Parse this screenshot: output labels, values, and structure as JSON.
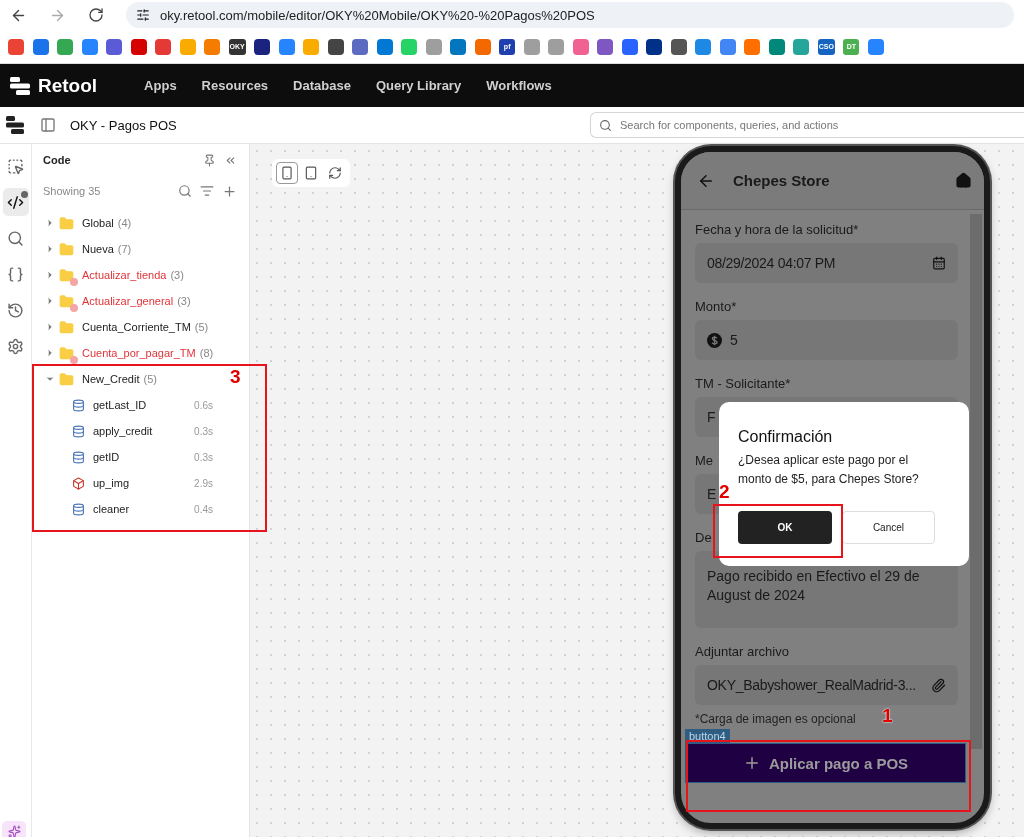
{
  "browser": {
    "url": "oky.retool.com/mobile/editor/OKY%20Mobile/OKY%20-%20Pagos%20POS",
    "bookmarks": [
      {
        "color": "#ea4335"
      },
      {
        "color": "#1a73e8"
      },
      {
        "color": "#34a853"
      },
      {
        "color": "#2684ff"
      },
      {
        "color": "#5b5bd6"
      },
      {
        "color": "#d50000"
      },
      {
        "color": "#e53935"
      },
      {
        "color": "#f9ab00"
      },
      {
        "color": "#f57c00"
      },
      {
        "color": "#333333",
        "label": "OKY"
      },
      {
        "color": "#1a237e"
      },
      {
        "color": "#2684ff"
      },
      {
        "color": "#f9ab00"
      },
      {
        "color": "#444444"
      },
      {
        "color": "#5c6bc0"
      },
      {
        "color": "#0078d4"
      },
      {
        "color": "#25d366"
      },
      {
        "color": "#9e9e9e"
      },
      {
        "color": "#0277bd"
      },
      {
        "color": "#f46800"
      },
      {
        "color": "#1e40af",
        "label": "pf"
      },
      {
        "color": "#9e9e9e"
      },
      {
        "color": "#9e9e9e"
      },
      {
        "color": "#f06292"
      },
      {
        "color": "#7e57c2"
      },
      {
        "color": "#2962ff"
      },
      {
        "color": "#003087"
      },
      {
        "color": "#555555"
      },
      {
        "color": "#1e88e5"
      },
      {
        "color": "#4285f4"
      },
      {
        "color": "#ff6f00"
      },
      {
        "color": "#00897b"
      },
      {
        "color": "#26a69a"
      },
      {
        "color": "#1565c0",
        "label": "CSO"
      },
      {
        "color": "#4caf50",
        "label": "DT"
      },
      {
        "color": "#2684ff"
      }
    ]
  },
  "nav": {
    "brand": "Retool",
    "links": [
      "Apps",
      "Resources",
      "Database",
      "Query Library",
      "Workflows"
    ]
  },
  "editor": {
    "title": "OKY - Pagos POS",
    "search": {
      "placeholder": "Search for components, queries, and actions"
    }
  },
  "rail": [
    {
      "kind": "select",
      "selected": false
    },
    {
      "kind": "code",
      "selected": true
    },
    {
      "kind": "search",
      "selected": false
    },
    {
      "kind": "state",
      "selected": false
    },
    {
      "kind": "history",
      "selected": false
    },
    {
      "kind": "settings",
      "selected": false
    }
  ],
  "code_panel": {
    "title": "Code",
    "showing": "Showing 35",
    "tree": [
      {
        "name": "Global",
        "count": "(4)",
        "warning": false,
        "expanded": false
      },
      {
        "name": "Nueva",
        "count": "(7)",
        "warning": false,
        "expanded": false
      },
      {
        "name": "Actualizar_tienda",
        "count": "(3)",
        "warning": true,
        "expanded": false
      },
      {
        "name": "Actualizar_general",
        "count": "(3)",
        "warning": true,
        "expanded": false
      },
      {
        "name": "Cuenta_Corriente_TM",
        "count": "(5)",
        "warning": false,
        "expanded": false
      },
      {
        "name": "Cuenta_por_pagar_TM",
        "count": "(8)",
        "warning": true,
        "expanded": false
      },
      {
        "name": "New_Credit",
        "count": "(5)",
        "warning": false,
        "expanded": true,
        "children": [
          {
            "kind": "sql",
            "name": "getLast_ID",
            "time": "0.6s"
          },
          {
            "kind": "sql",
            "name": "apply_credit",
            "time": "0.3s"
          },
          {
            "kind": "sql",
            "name": "getID",
            "time": "0.3s"
          },
          {
            "kind": "s3",
            "name": "up_img",
            "time": "2.9s"
          },
          {
            "kind": "sql",
            "name": "cleaner",
            "time": "0.4s"
          }
        ]
      }
    ]
  },
  "canvas_toolbar": [
    {
      "kind": "phone",
      "selected": true
    },
    {
      "kind": "tablet",
      "selected": false
    },
    {
      "kind": "rotate",
      "selected": false
    }
  ],
  "phone": {
    "header": "Chepes Store",
    "fields": [
      {
        "label": "Fecha y hora de la solicitud*",
        "value": "08/29/2024 04:07 PM",
        "kind": "date"
      },
      {
        "label": "Monto*",
        "value": "5",
        "kind": "money"
      },
      {
        "label": "TM - Solicitante*",
        "value": "F",
        "kind": "text"
      },
      {
        "label": "Me",
        "value": "E",
        "kind": "text"
      },
      {
        "label": "De",
        "value": "Pago recibido en Efectivo el 29 de August de 2024",
        "kind": "area"
      },
      {
        "label": "Adjuntar archivo",
        "value": "OKY_Babyshower_RealMadrid-3...",
        "kind": "file"
      }
    ],
    "hint": "*Carga de imagen es opcional",
    "tag": "button4",
    "button": "Aplicar pago a POS",
    "modal": {
      "title": "Confirmación",
      "message": "¿Desea aplicar este pago por el monto de $5, para Chepes Store?",
      "ok": "OK",
      "cancel": "Cancel"
    }
  },
  "annotations": [
    "1",
    "2",
    "3"
  ]
}
